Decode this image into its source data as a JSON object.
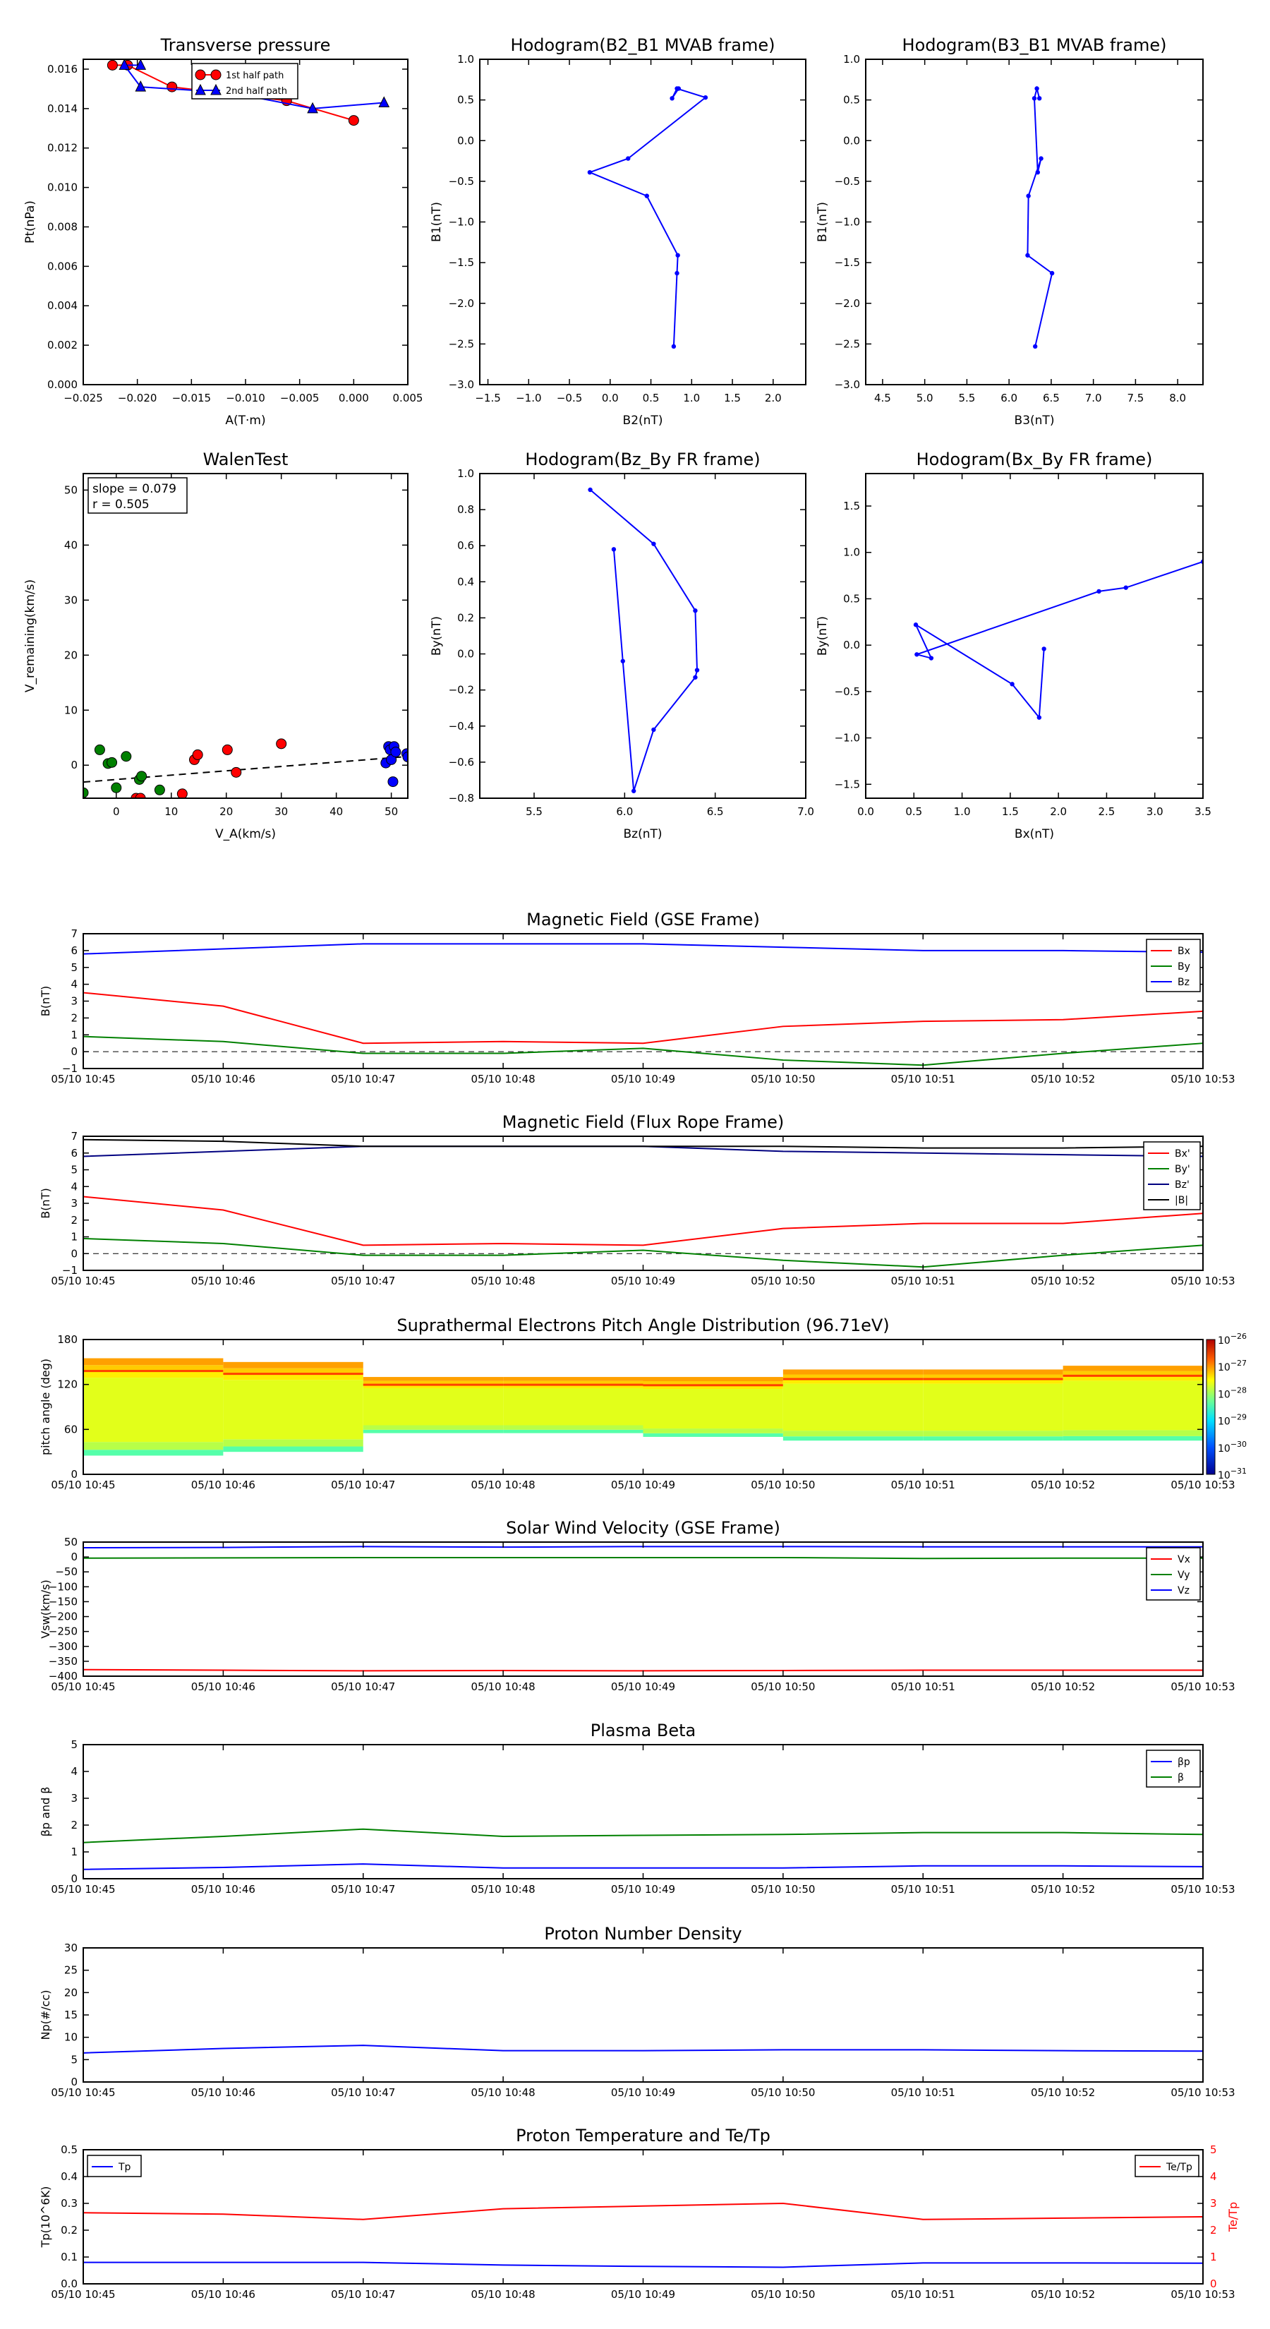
{
  "colors": {
    "red": "#ff0000",
    "green": "#008000",
    "blue": "#0000ff",
    "black": "#000000",
    "navy": "#000080"
  },
  "chart_data": [
    {
      "type": "line",
      "title": "Transverse pressure",
      "xlabel": "A(T·m)",
      "ylabel": "Pt(nPa)",
      "xlim": [
        -0.025,
        0.005
      ],
      "ylim": [
        0,
        0.0165
      ],
      "xticks": [
        "−0.025",
        "−0.020",
        "−0.015",
        "−0.010",
        "−0.005",
        "0.000",
        "0.005"
      ],
      "yticks": [
        "0.000",
        "0.002",
        "0.004",
        "0.006",
        "0.008",
        "0.010",
        "0.012",
        "0.014",
        "0.016"
      ],
      "legend_position": "top-right",
      "series": [
        {
          "name": "1st half path",
          "color": "#ff0000",
          "marker": "circle",
          "x": [
            -0.0223,
            -0.0209,
            -0.0168,
            -0.0062,
            0.0
          ],
          "y": [
            0.0162,
            0.0162,
            0.0151,
            0.0144,
            0.0134
          ]
        },
        {
          "name": "2nd half path",
          "color": "#0000ff",
          "marker": "triangle",
          "x": [
            0.0028,
            -0.0038,
            -0.0113,
            -0.0197,
            -0.0212,
            -0.0197
          ],
          "y": [
            0.0143,
            0.014,
            0.0148,
            0.0151,
            0.0162,
            0.0162
          ]
        }
      ]
    },
    {
      "type": "line",
      "title": "Hodogram(B2_B1 MVAB frame)",
      "xlabel": "B2(nT)",
      "ylabel": "B1(nT)",
      "xlim": [
        -1.6,
        2.4
      ],
      "ylim": [
        -3.0,
        1.0
      ],
      "xticks": [
        "−1.5",
        "−1.0",
        "−0.5",
        "0.0",
        "0.5",
        "1.0",
        "1.5",
        "2.0"
      ],
      "yticks": [
        "−3.0",
        "−2.5",
        "−2.0",
        "−1.5",
        "−1.0",
        "−0.5",
        "0.0",
        "0.5",
        "1.0"
      ],
      "series": [
        {
          "color": "#0000ff",
          "marker": "dot",
          "x": [
            0.78,
            0.82,
            0.83,
            0.45,
            -0.25,
            0.22,
            1.17,
            0.82,
            0.76,
            0.84
          ],
          "y": [
            -2.53,
            -1.63,
            -1.41,
            -0.68,
            -0.39,
            -0.22,
            0.53,
            0.64,
            0.52,
            0.64
          ]
        }
      ]
    },
    {
      "type": "line",
      "title": "Hodogram(B3_B1 MVAB frame)",
      "xlabel": "B3(nT)",
      "ylabel": "B1(nT)",
      "xlim": [
        4.3,
        8.3
      ],
      "ylim": [
        -3.0,
        1.0
      ],
      "xticks": [
        "4.5",
        "5.0",
        "5.5",
        "6.0",
        "6.5",
        "7.0",
        "7.5",
        "8.0"
      ],
      "yticks": [
        "−3.0",
        "−2.5",
        "−2.0",
        "−1.5",
        "−1.0",
        "−0.5",
        "0.0",
        "0.5",
        "1.0"
      ],
      "series": [
        {
          "color": "#0000ff",
          "marker": "dot",
          "x": [
            6.31,
            6.51,
            6.22,
            6.23,
            6.38,
            6.34,
            6.3,
            6.33,
            6.36
          ],
          "y": [
            -2.53,
            -1.63,
            -1.41,
            -0.68,
            -0.22,
            -0.39,
            0.52,
            0.64,
            0.52
          ]
        }
      ]
    },
    {
      "type": "scatter",
      "title": "WalenTest",
      "xlabel": "V_A(km/s)",
      "ylabel": "V_remaining(km/s)",
      "xlim": [
        -6,
        53
      ],
      "ylim": [
        -6,
        53
      ],
      "xticks": [
        "0",
        "10",
        "20",
        "30",
        "40",
        "50"
      ],
      "yticks": [
        "0",
        "10",
        "20",
        "30",
        "40",
        "50"
      ],
      "annotation": [
        "slope = 0.079",
        "r = 0.505"
      ],
      "fit": {
        "slope": 0.079,
        "intercept": -2.6
      },
      "series": [
        {
          "color": "#ff0000",
          "x": [
            3.6,
            4.4,
            12.0,
            14.2,
            14.8,
            20.2,
            21.8,
            30.0
          ],
          "y": [
            -6.0,
            -6.0,
            -5.2,
            1.0,
            1.9,
            2.8,
            -1.3,
            3.9
          ]
        },
        {
          "color": "#008000",
          "x": [
            -6.0,
            -3.0,
            -1.5,
            -0.8,
            0.0,
            1.8,
            4.2,
            4.6,
            7.9
          ],
          "y": [
            -5.0,
            2.8,
            0.3,
            0.5,
            -4.1,
            1.6,
            -2.6,
            -2.0,
            -4.5
          ]
        },
        {
          "color": "#0000ff",
          "x": [
            49.0,
            49.5,
            49.8,
            50.0,
            50.3,
            50.5,
            50.8,
            52.8,
            53.0
          ],
          "y": [
            0.4,
            3.4,
            2.8,
            1.0,
            -3.0,
            3.4,
            2.4,
            2.1,
            1.5
          ]
        }
      ]
    },
    {
      "type": "line",
      "title": "Hodogram(Bz_By FR frame)",
      "xlabel": "Bz(nT)",
      "ylabel": "By(nT)",
      "xlim": [
        5.2,
        7.0
      ],
      "ylim": [
        -0.8,
        1.0
      ],
      "xticks": [
        "5.5",
        "6.0",
        "6.5",
        "7.0"
      ],
      "yticks": [
        "−0.8",
        "−0.6",
        "−0.4",
        "−0.2",
        "0.0",
        "0.2",
        "0.4",
        "0.6",
        "0.8",
        "1.0"
      ],
      "series": [
        {
          "color": "#0000ff",
          "marker": "dot",
          "x": [
            5.81,
            6.16,
            6.39,
            6.4,
            6.39,
            6.16,
            6.05,
            5.99,
            5.94
          ],
          "y": [
            0.91,
            0.61,
            0.24,
            -0.09,
            -0.13,
            -0.42,
            -0.76,
            -0.04,
            0.58
          ]
        }
      ]
    },
    {
      "type": "line",
      "title": "Hodogram(Bx_By FR frame)",
      "xlabel": "Bx(nT)",
      "ylabel": "By(nT)",
      "xlim": [
        0.0,
        3.5
      ],
      "ylim": [
        -1.65,
        1.85
      ],
      "xticks": [
        "0.0",
        "0.5",
        "1.0",
        "1.5",
        "2.0",
        "2.5",
        "3.0",
        "3.5"
      ],
      "yticks": [
        "−1.5",
        "−1.0",
        "−0.5",
        "0.0",
        "0.5",
        "1.0",
        "1.5"
      ],
      "series": [
        {
          "color": "#0000ff",
          "marker": "dot",
          "x": [
            3.5,
            2.7,
            2.42,
            0.53,
            0.68,
            0.52,
            1.52,
            1.8,
            1.85
          ],
          "y": [
            0.9,
            0.62,
            0.58,
            -0.1,
            -0.14,
            0.22,
            -0.42,
            -0.78,
            -0.04
          ]
        }
      ]
    },
    {
      "type": "line",
      "title": "Magnetic Field (GSE Frame)",
      "ylabel": "B(nT)",
      "ylim": [
        -1,
        7
      ],
      "legend_position": "top-right",
      "categories": [
        "05/10 10:45",
        "05/10 10:46",
        "05/10 10:47",
        "05/10 10:48",
        "05/10 10:49",
        "05/10 10:50",
        "05/10 10:51",
        "05/10 10:52",
        "05/10 10:53"
      ],
      "yticks": [
        "−1",
        "0",
        "1",
        "2",
        "3",
        "4",
        "5",
        "6",
        "7"
      ],
      "zero_line": true,
      "series": [
        {
          "name": "Bx",
          "color": "#ff0000",
          "values": [
            3.5,
            2.7,
            0.5,
            0.6,
            0.5,
            1.5,
            1.8,
            1.9,
            2.4
          ]
        },
        {
          "name": "By",
          "color": "#008000",
          "values": [
            0.9,
            0.6,
            -0.1,
            -0.1,
            0.2,
            -0.5,
            -0.8,
            -0.1,
            0.5
          ]
        },
        {
          "name": "Bz",
          "color": "#0000ff",
          "values": [
            5.8,
            6.1,
            6.4,
            6.4,
            6.4,
            6.2,
            6.0,
            6.0,
            5.9
          ]
        }
      ]
    },
    {
      "type": "line",
      "title": "Magnetic Field (Flux Rope Frame)",
      "ylabel": "B(nT)",
      "ylim": [
        -1,
        7
      ],
      "legend_position": "top-right",
      "categories": [
        "05/10 10:45",
        "05/10 10:46",
        "05/10 10:47",
        "05/10 10:48",
        "05/10 10:49",
        "05/10 10:50",
        "05/10 10:51",
        "05/10 10:52",
        "05/10 10:53"
      ],
      "yticks": [
        "−1",
        "0",
        "1",
        "2",
        "3",
        "4",
        "5",
        "6",
        "7"
      ],
      "zero_line": true,
      "series": [
        {
          "name": "Bx'",
          "color": "#ff0000",
          "values": [
            3.4,
            2.6,
            0.5,
            0.6,
            0.5,
            1.5,
            1.8,
            1.8,
            2.4
          ]
        },
        {
          "name": "By'",
          "color": "#008000",
          "values": [
            0.9,
            0.6,
            -0.1,
            -0.1,
            0.2,
            -0.4,
            -0.8,
            -0.1,
            0.5
          ]
        },
        {
          "name": "Bz'",
          "color": "#000080",
          "values": [
            5.8,
            6.1,
            6.4,
            6.4,
            6.4,
            6.1,
            6.0,
            5.9,
            5.8
          ]
        },
        {
          "name": "|B|",
          "color": "#000000",
          "values": [
            6.8,
            6.7,
            6.4,
            6.4,
            6.4,
            6.4,
            6.3,
            6.3,
            6.4
          ]
        }
      ]
    },
    {
      "type": "heatmap",
      "title": "Suprathermal Electrons Pitch Angle Distribution (96.71eV)",
      "ylabel": "pitch angle (deg)",
      "ylim": [
        0,
        180
      ],
      "categories": [
        "05/10 10:45",
        "05/10 10:46",
        "05/10 10:47",
        "05/10 10:48",
        "05/10 10:49",
        "05/10 10:50",
        "05/10 10:51",
        "05/10 10:52",
        "05/10 10:53"
      ],
      "yticks": [
        "0",
        "60",
        "120",
        "180"
      ],
      "colorbar": {
        "labels": [
          "10^-26",
          "10^-27",
          "10^-28",
          "10^-29",
          "10^-30",
          "10^-31"
        ]
      },
      "columns": [
        {
          "start": 0,
          "end": 1,
          "low": 25,
          "high": 155
        },
        {
          "start": 1,
          "end": 2,
          "low": 30,
          "high": 150
        },
        {
          "start": 2,
          "end": 3,
          "low": 55,
          "high": 130
        },
        {
          "start": 3,
          "end": 4,
          "low": 55,
          "high": 130
        },
        {
          "start": 4,
          "end": 5,
          "low": 50,
          "high": 130
        },
        {
          "start": 5,
          "end": 6,
          "low": 45,
          "high": 140
        },
        {
          "start": 6,
          "end": 7,
          "low": 45,
          "high": 140
        },
        {
          "start": 7,
          "end": 8,
          "low": 45,
          "high": 145
        }
      ]
    },
    {
      "type": "line",
      "title": "Solar Wind Velocity (GSE Frame)",
      "ylabel": "Vsw(km/s)",
      "ylim": [
        -400,
        50
      ],
      "legend_position": "top-right",
      "categories": [
        "05/10 10:45",
        "05/10 10:46",
        "05/10 10:47",
        "05/10 10:48",
        "05/10 10:49",
        "05/10 10:50",
        "05/10 10:51",
        "05/10 10:52",
        "05/10 10:53"
      ],
      "yticks": [
        "−400",
        "−350",
        "−300",
        "−250",
        "−200",
        "−150",
        "−100",
        "−50",
        "0",
        "50"
      ],
      "series": [
        {
          "name": "Vx",
          "color": "#ff0000",
          "values": [
            -378,
            -380,
            -382,
            -381,
            -382,
            -381,
            -380,
            -380,
            -380
          ]
        },
        {
          "name": "Vy",
          "color": "#008000",
          "values": [
            -4,
            -3,
            -2,
            -2,
            -2,
            -2,
            -5,
            -4,
            -4
          ]
        },
        {
          "name": "Vz",
          "color": "#0000ff",
          "values": [
            31,
            32,
            35,
            33,
            35,
            35,
            34,
            34,
            34
          ]
        }
      ]
    },
    {
      "type": "line",
      "title": "Plasma Beta",
      "ylabel": "βp and β",
      "ylim": [
        0,
        5
      ],
      "legend_position": "top-right",
      "categories": [
        "05/10 10:45",
        "05/10 10:46",
        "05/10 10:47",
        "05/10 10:48",
        "05/10 10:49",
        "05/10 10:50",
        "05/10 10:51",
        "05/10 10:52",
        "05/10 10:53"
      ],
      "yticks": [
        "0",
        "1",
        "2",
        "3",
        "4",
        "5"
      ],
      "series": [
        {
          "name": "βp",
          "color": "#0000ff",
          "values": [
            0.35,
            0.42,
            0.55,
            0.4,
            0.4,
            0.4,
            0.48,
            0.48,
            0.45
          ]
        },
        {
          "name": "β",
          "color": "#008000",
          "values": [
            1.35,
            1.58,
            1.85,
            1.58,
            1.62,
            1.65,
            1.72,
            1.72,
            1.65
          ]
        }
      ]
    },
    {
      "type": "line",
      "title": "Proton Number Density",
      "ylabel": "Np(#/cc)",
      "ylim": [
        0,
        30
      ],
      "categories": [
        "05/10 10:45",
        "05/10 10:46",
        "05/10 10:47",
        "05/10 10:48",
        "05/10 10:49",
        "05/10 10:50",
        "05/10 10:51",
        "05/10 10:52",
        "05/10 10:53"
      ],
      "yticks": [
        "0",
        "5",
        "10",
        "15",
        "20",
        "25",
        "30"
      ],
      "series": [
        {
          "color": "#0000ff",
          "values": [
            6.5,
            7.5,
            8.2,
            7.0,
            7.0,
            7.2,
            7.2,
            7.0,
            6.9
          ]
        }
      ]
    },
    {
      "type": "line",
      "title": "Proton Temperature and Te/Tp",
      "ylabel": "Tp(10^6K)",
      "y2label": "Te/Tp",
      "ylim": [
        0,
        0.5
      ],
      "y2lim": [
        0,
        5
      ],
      "categories": [
        "05/10 10:45",
        "05/10 10:46",
        "05/10 10:47",
        "05/10 10:48",
        "05/10 10:49",
        "05/10 10:50",
        "05/10 10:51",
        "05/10 10:52",
        "05/10 10:53"
      ],
      "yticks": [
        "0.0",
        "0.1",
        "0.2",
        "0.3",
        "0.4",
        "0.5"
      ],
      "y2ticks": [
        "0",
        "1",
        "2",
        "3",
        "4",
        "5"
      ],
      "series": [
        {
          "name": "Tp",
          "color": "#0000ff",
          "axis": "left",
          "values": [
            0.08,
            0.08,
            0.08,
            0.07,
            0.065,
            0.062,
            0.078,
            0.078,
            0.077
          ]
        },
        {
          "name": "Te/Tp",
          "color": "#ff0000",
          "axis": "right",
          "values": [
            2.65,
            2.6,
            2.4,
            2.8,
            2.9,
            3.0,
            2.4,
            2.45,
            2.5
          ]
        }
      ]
    }
  ]
}
